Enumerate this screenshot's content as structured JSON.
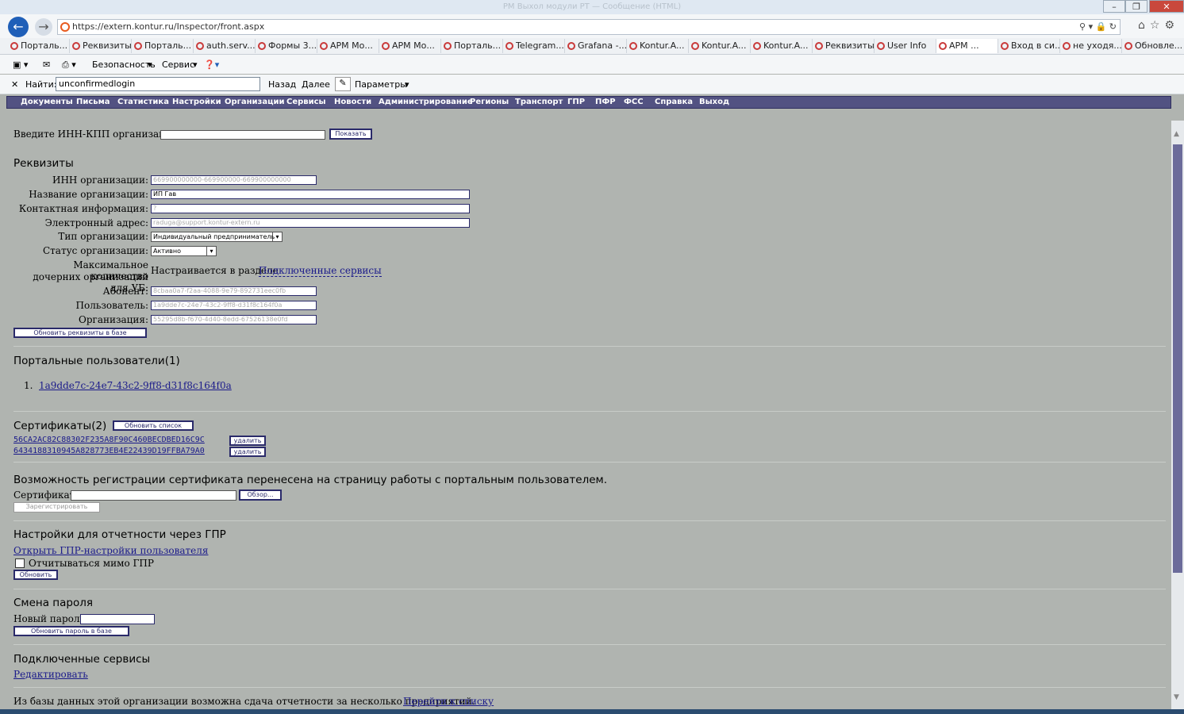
{
  "browser": {
    "window_title": "РМ Выхол модули РТ — Сообщение (HTML)",
    "url": "https://extern.kontur.ru/Inspector/front.aspx",
    "tabs": [
      "Порталь...",
      "Реквизиты",
      "Порталь...",
      "auth.serv...",
      "Формы 3...",
      "АРМ Мо...",
      "АРМ Мо...",
      "Порталь...",
      "Telegram...",
      "Grafana -...",
      "Kontur.A...",
      "Kontur.A...",
      "Kontur.A...",
      "Реквизиты",
      "User Info",
      "АРМ ...",
      "Вход в си...",
      "не уходя...",
      "Обновле..."
    ],
    "cmd": {
      "security": "Безопасность",
      "service": "Сервис"
    },
    "find": {
      "label": "Найти:",
      "value": "unconfirmedlogin",
      "back": "Назад",
      "next": "Далее",
      "params": "Параметры"
    }
  },
  "menu": [
    "Документы",
    "Письма",
    "Статистика",
    "Настройки",
    "Организации",
    "Сервисы",
    "Новости",
    "Администрирование",
    "Регионы",
    "Транспорт",
    "ГПР",
    "ПФР",
    "ФСС",
    "Справка",
    "Выход"
  ],
  "search": {
    "label": "Введите ИНН-КПП организации:",
    "button": "Показать"
  },
  "requisites": {
    "title": "Реквизиты",
    "inn": {
      "label": "ИНН организации:",
      "value": "669900000000-669900000-669900000000"
    },
    "name": {
      "label": "Название организации:",
      "value": "ИП Гав"
    },
    "contact": {
      "label": "Контактная информация:",
      "value": "?"
    },
    "email": {
      "label": "Электронный адрес:",
      "value": "raduga@support.kontur-extern.ru"
    },
    "type": {
      "label": "Тип организации:",
      "value": "Индивидуальный предприниматель"
    },
    "status": {
      "label": "Статус организации:",
      "value": "Активно"
    },
    "max_sub": {
      "label1": "Максимальное количество",
      "label2": "дочерних организаций для УБ:",
      "text": "Настраивается в разделе",
      "link": "Подключенные сервисы"
    },
    "abonent": {
      "label": "Абонент:",
      "value": "8cbaa0a7-f2aa-4088-9e79-892731eec0fb"
    },
    "user": {
      "label": "Пользователь:",
      "value": "1a9dde7c-24e7-43c2-9ff8-d31f8c164f0a"
    },
    "org": {
      "label": "Организация:",
      "value": "55295d8b-f670-4d40-8edd-67526138e0fd"
    },
    "update_button": "Обновить реквизиты в базе"
  },
  "portal_users": {
    "title": "Портальные пользователи(1)",
    "items": [
      "1a9dde7c-24e7-43c2-9ff8-d31f8c164f0a"
    ]
  },
  "certificates": {
    "title": "Сертификаты(2)",
    "refresh": "Обновить список",
    "items": [
      {
        "id": "56CA2AC82C88302F235A8F90C460BECDBED16C9C",
        "del": "удалить"
      },
      {
        "id": "6434188310945A828773EB4E22439D19FFBA79A0",
        "del": "удалить"
      }
    ]
  },
  "cert_reg": {
    "note": "Возможность регистрации сертификата перенесена на страницу работы с портальным пользователем.",
    "label": "Сертификат:",
    "browse": "Обзор...",
    "register": "Зарегистрировать"
  },
  "gpr": {
    "title": "Настройки для отчетности через ГПР",
    "link": "Открыть ГПР-настройки пользователя",
    "checkbox": "Отчитываться мимо ГПР",
    "update": "Обновить"
  },
  "password": {
    "title": "Смена пароля",
    "label": "Новый пароль:",
    "button": "Обновить пароль в базе"
  },
  "services": {
    "title": "Подключенные сервисы",
    "link": "Редактировать"
  },
  "footer": {
    "text": "Из базы данных этой организации возможна сдача отчетности за несколько предприятий.",
    "link": "Перейти к списку"
  }
}
